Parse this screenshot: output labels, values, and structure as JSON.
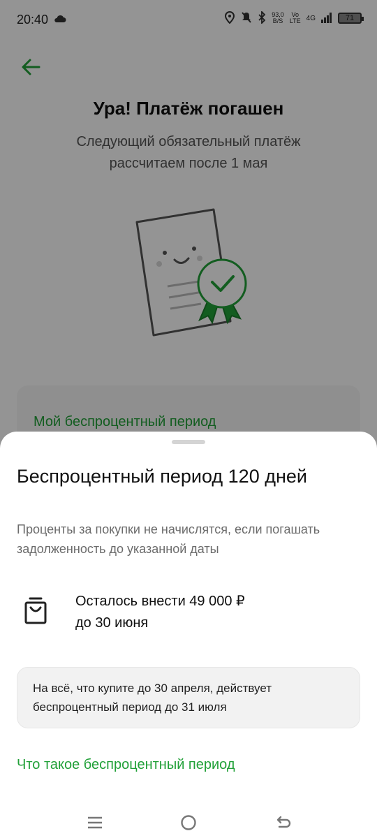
{
  "status_bar": {
    "time": "20:40",
    "net_speed_value": "93,0",
    "net_speed_unit": "B/S",
    "volte_top": "Vo",
    "volte_bottom": "LTE",
    "network": "4G",
    "battery": "71"
  },
  "background": {
    "title": "Ура! Платёж погашен",
    "subtitle": "Следующий обязательный платёж рассчитаем после 1 мая",
    "card_title": "Мой беспроцентный период"
  },
  "sheet": {
    "title": "Беспроцентный период 120 дней",
    "description": "Проценты за покупки не начислятся, если погашать задолженность до указанной даты",
    "remaining_line1": "Осталось внести 49 000 ₽",
    "remaining_line2": "до 30 июня",
    "info_text": "На всё, что купите до 30 апреля, действует беспроцентный период до 31 июля",
    "link_text": "Что такое беспроцентный период"
  },
  "colors": {
    "accent": "#21a038",
    "overlay": "rgba(0,0,0,0.42)"
  },
  "icons": [
    "back-arrow-icon",
    "cloud-icon",
    "location-icon",
    "mute-icon",
    "bluetooth-icon",
    "signal-icon",
    "battery-icon",
    "shopping-bag-icon",
    "menu-icon",
    "home-icon",
    "back-icon"
  ]
}
